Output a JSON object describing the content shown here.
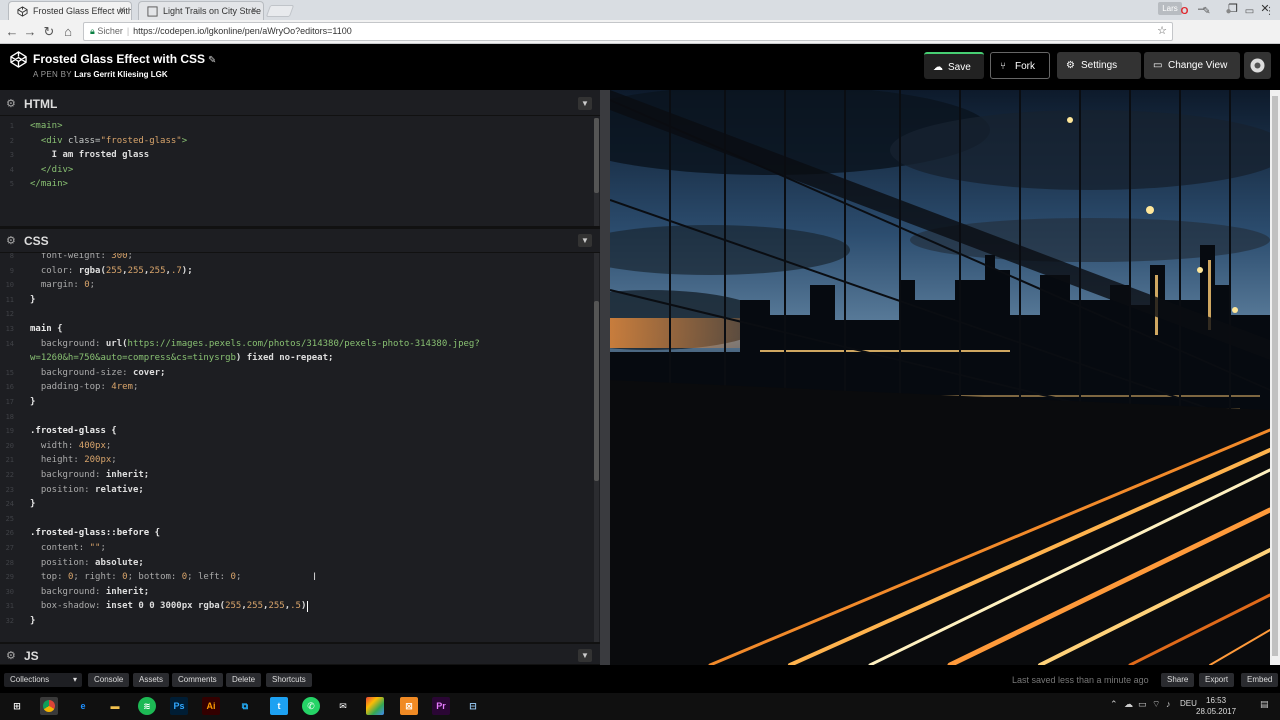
{
  "browser": {
    "tabs": [
      {
        "title": "Frosted Glass Effect with"
      },
      {
        "title": "Light Trails on City Stree"
      }
    ],
    "user_badge": "Lars",
    "secure_label": "Sicher",
    "url": "https://codepen.io/lgkonline/pen/aWryOo?editors=1100",
    "icons": [
      "back-arrow-icon",
      "forward-arrow-icon",
      "reload-icon",
      "home-icon",
      "star-icon",
      "opera-icon",
      "extension-icon"
    ]
  },
  "pen": {
    "title": "Frosted Glass Effect with CSS",
    "by_prefix": "A PEN BY",
    "author": "Lars Gerrit Kliesing LGK",
    "buttons": {
      "save": "Save",
      "fork": "Fork",
      "settings": "Settings",
      "change_view": "Change View"
    }
  },
  "panes": {
    "html": {
      "name": "HTML",
      "lines": [
        {
          "n": "1",
          "segs": [
            {
              "t": "<main>",
              "c": "t-tag"
            }
          ]
        },
        {
          "n": "2",
          "segs": [
            {
              "t": "  <div ",
              "c": "t-tag"
            },
            {
              "t": "class=",
              "c": "t-attr"
            },
            {
              "t": "\"frosted-glass\"",
              "c": "t-str"
            },
            {
              "t": ">",
              "c": "t-tag"
            }
          ]
        },
        {
          "n": "3",
          "segs": [
            {
              "t": "    I am frosted glass",
              "c": "t-val"
            }
          ]
        },
        {
          "n": "4",
          "segs": [
            {
              "t": "  </div>",
              "c": "t-tag"
            }
          ]
        },
        {
          "n": "5",
          "segs": [
            {
              "t": "</main>",
              "c": "t-tag"
            }
          ]
        }
      ]
    },
    "css": {
      "name": "CSS",
      "lines": [
        {
          "n": "8",
          "segs": [
            {
              "t": "  font-weight: ",
              "c": "t-prop"
            },
            {
              "t": "300",
              "c": "t-num"
            },
            {
              "t": ";",
              "c": "t-prop"
            }
          ]
        },
        {
          "n": "9",
          "segs": [
            {
              "t": "  color: ",
              "c": "t-prop"
            },
            {
              "t": "rgba(",
              "c": "t-val"
            },
            {
              "t": "255",
              "c": "t-num"
            },
            {
              "t": ",",
              "c": "t-val"
            },
            {
              "t": "255",
              "c": "t-num"
            },
            {
              "t": ",",
              "c": "t-val"
            },
            {
              "t": "255",
              "c": "t-num"
            },
            {
              "t": ",",
              "c": "t-val"
            },
            {
              "t": ".7",
              "c": "t-num"
            },
            {
              "t": ");",
              "c": "t-val"
            }
          ]
        },
        {
          "n": "10",
          "segs": [
            {
              "t": "  margin: ",
              "c": "t-prop"
            },
            {
              "t": "0",
              "c": "t-num"
            },
            {
              "t": ";",
              "c": "t-prop"
            }
          ]
        },
        {
          "n": "11",
          "segs": [
            {
              "t": "}",
              "c": "t-sel"
            }
          ]
        },
        {
          "n": "12",
          "segs": [
            {
              "t": "",
              "c": "t-prop"
            }
          ]
        },
        {
          "n": "13",
          "segs": [
            {
              "t": "main {",
              "c": "t-sel"
            }
          ]
        },
        {
          "n": "14",
          "segs": [
            {
              "t": "  background: ",
              "c": "t-prop"
            },
            {
              "t": "url(",
              "c": "t-val"
            },
            {
              "t": "https://images.pexels.com/photos/314380/pexels-photo-314380.jpeg?",
              "c": "t-url"
            }
          ]
        },
        {
          "n": "",
          "segs": [
            {
              "t": "w=1260&h=750&auto=compress&cs=tinysrgb",
              "c": "t-url"
            },
            {
              "t": ") fixed no-repeat;",
              "c": "t-val"
            }
          ]
        },
        {
          "n": "15",
          "segs": [
            {
              "t": "  background-size: ",
              "c": "t-prop"
            },
            {
              "t": "cover;",
              "c": "t-val"
            }
          ]
        },
        {
          "n": "16",
          "segs": [
            {
              "t": "  padding-top: ",
              "c": "t-prop"
            },
            {
              "t": "4rem",
              "c": "t-num"
            },
            {
              "t": ";",
              "c": "t-prop"
            }
          ]
        },
        {
          "n": "17",
          "segs": [
            {
              "t": "}",
              "c": "t-sel"
            }
          ]
        },
        {
          "n": "18",
          "segs": [
            {
              "t": "",
              "c": "t-prop"
            }
          ]
        },
        {
          "n": "19",
          "segs": [
            {
              "t": ".frosted-glass {",
              "c": "t-sel"
            }
          ]
        },
        {
          "n": "20",
          "segs": [
            {
              "t": "  width: ",
              "c": "t-prop"
            },
            {
              "t": "400px",
              "c": "t-num"
            },
            {
              "t": ";",
              "c": "t-prop"
            }
          ]
        },
        {
          "n": "21",
          "segs": [
            {
              "t": "  height: ",
              "c": "t-prop"
            },
            {
              "t": "200px",
              "c": "t-num"
            },
            {
              "t": ";",
              "c": "t-prop"
            }
          ]
        },
        {
          "n": "22",
          "segs": [
            {
              "t": "  background: ",
              "c": "t-prop"
            },
            {
              "t": "inherit;",
              "c": "t-val"
            }
          ]
        },
        {
          "n": "23",
          "segs": [
            {
              "t": "  position: ",
              "c": "t-prop"
            },
            {
              "t": "relative;",
              "c": "t-val"
            }
          ]
        },
        {
          "n": "24",
          "segs": [
            {
              "t": "}",
              "c": "t-sel"
            }
          ]
        },
        {
          "n": "25",
          "segs": [
            {
              "t": "",
              "c": "t-prop"
            }
          ]
        },
        {
          "n": "26",
          "segs": [
            {
              "t": ".frosted-glass::before {",
              "c": "t-sel"
            }
          ]
        },
        {
          "n": "27",
          "segs": [
            {
              "t": "  content: ",
              "c": "t-prop"
            },
            {
              "t": "\"\"",
              "c": "t-str"
            },
            {
              "t": ";",
              "c": "t-prop"
            }
          ]
        },
        {
          "n": "28",
          "segs": [
            {
              "t": "  position: ",
              "c": "t-prop"
            },
            {
              "t": "absolute;",
              "c": "t-val"
            }
          ]
        },
        {
          "n": "29",
          "segs": [
            {
              "t": "  top: ",
              "c": "t-prop"
            },
            {
              "t": "0",
              "c": "t-num"
            },
            {
              "t": "; right: ",
              "c": "t-prop"
            },
            {
              "t": "0",
              "c": "t-num"
            },
            {
              "t": "; bottom: ",
              "c": "t-prop"
            },
            {
              "t": "0",
              "c": "t-num"
            },
            {
              "t": "; left: ",
              "c": "t-prop"
            },
            {
              "t": "0",
              "c": "t-num"
            },
            {
              "t": ";",
              "c": "t-prop"
            }
          ]
        },
        {
          "n": "30",
          "segs": [
            {
              "t": "  background: ",
              "c": "t-prop"
            },
            {
              "t": "inherit;",
              "c": "t-val"
            }
          ]
        },
        {
          "n": "31",
          "segs": [
            {
              "t": "  box-shadow: ",
              "c": "t-prop"
            },
            {
              "t": "inset 0 0 3000px ",
              "c": "t-val"
            },
            {
              "t": "rgba(",
              "c": "t-val"
            },
            {
              "t": "255",
              "c": "t-num"
            },
            {
              "t": ",",
              "c": "t-val"
            },
            {
              "t": "255",
              "c": "t-num"
            },
            {
              "t": ",",
              "c": "t-val"
            },
            {
              "t": "255",
              "c": "t-num"
            },
            {
              "t": ",",
              "c": "t-val"
            },
            {
              "t": ".5",
              "c": "t-num"
            },
            {
              "t": ")",
              "c": "t-val"
            }
          ]
        },
        {
          "n": "32",
          "segs": [
            {
              "t": "}",
              "c": "t-sel"
            }
          ]
        }
      ]
    },
    "js": {
      "name": "JS"
    }
  },
  "footer": {
    "collections": "Collections",
    "buttons": [
      "Console",
      "Assets",
      "Comments",
      "Delete",
      "Shortcuts"
    ],
    "last_saved": "Last saved less than a minute ago",
    "right_buttons": [
      "Share",
      "Export",
      "Embed"
    ]
  },
  "taskbar": {
    "time": "16:53",
    "date": "28.05.2017",
    "lang": "DEU"
  },
  "colors": {
    "accent": "#47cf73",
    "header_bg": "#000000",
    "editor_bg": "#1d1e22"
  }
}
